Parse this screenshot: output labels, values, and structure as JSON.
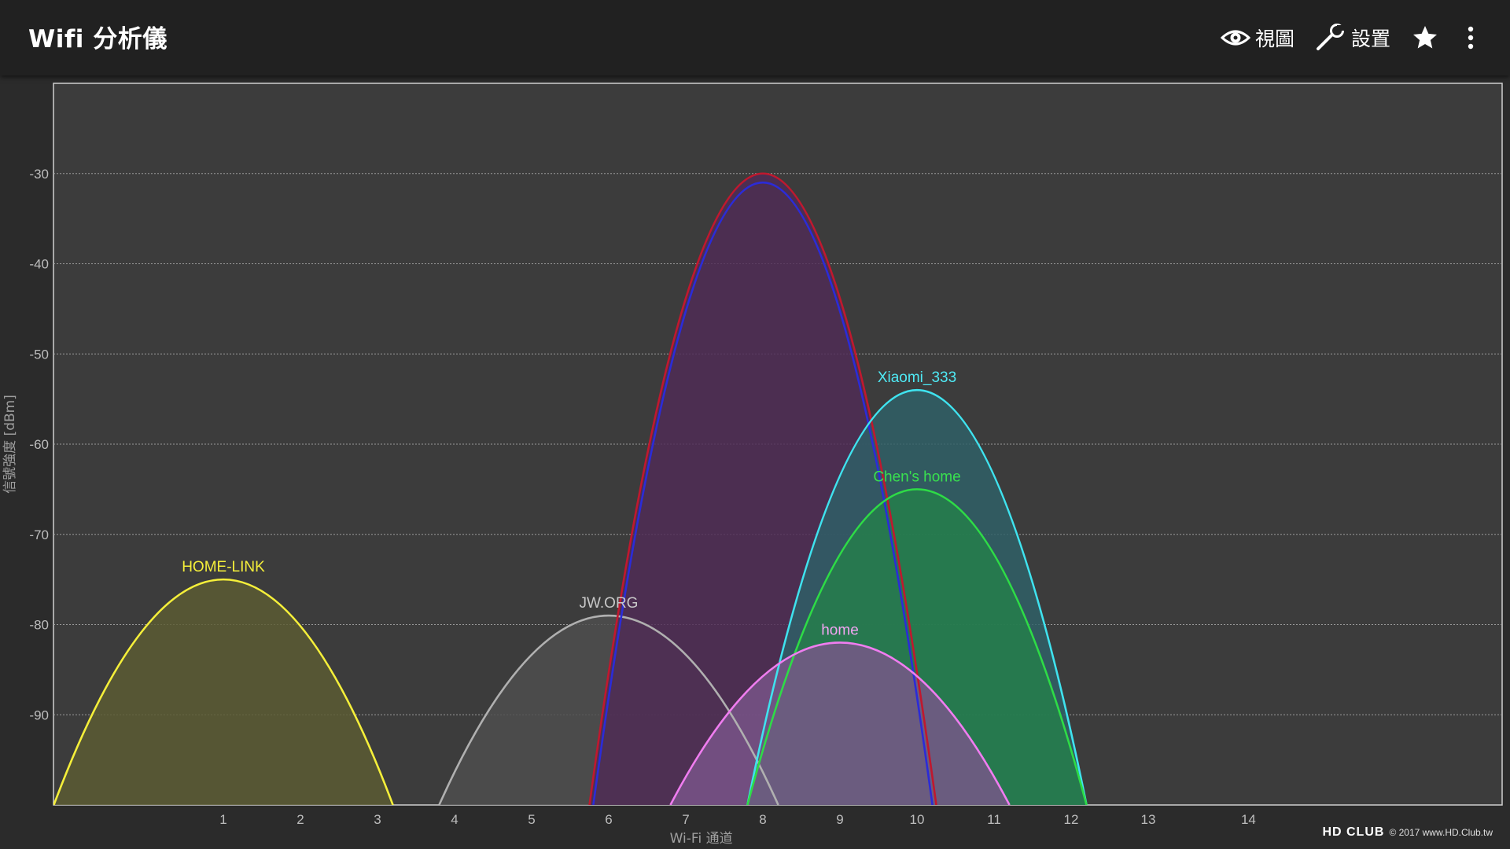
{
  "appbar": {
    "title": "Wifi 分析儀",
    "view_label": "視圖",
    "settings_label": "設置",
    "view_icon": "eye-icon",
    "settings_icon": "wrench-icon",
    "favorite_icon": "star-icon",
    "more_icon": "more-vert-icon"
  },
  "chart_data": {
    "type": "area",
    "xlabel": "Wi-Fi 通道",
    "ylabel": "信號強度 [dBm]",
    "x_ticks": [
      "1",
      "2",
      "3",
      "4",
      "5",
      "6",
      "7",
      "8",
      "9",
      "10",
      "11",
      "12",
      "13",
      "14"
    ],
    "y_ticks": [
      "-30",
      "-40",
      "-50",
      "-60",
      "-70",
      "-80",
      "-90"
    ],
    "ylim": [
      -100,
      -20
    ],
    "grid": true,
    "series": [
      {
        "name": "HOME-LINK",
        "channel": 1,
        "start": -1.2,
        "end": 3.2,
        "peak": -75,
        "stroke": "#f5ef3a",
        "fill": "#5c5b32",
        "label_color": "#f5ef3a",
        "show_label": true
      },
      {
        "name": "JW.ORG",
        "channel": 6,
        "start": 3.8,
        "end": 8.2,
        "peak": -79,
        "stroke": "#b0b0b0",
        "fill": "#4e4e4e",
        "label_color": "#c8c8c8",
        "show_label": true
      },
      {
        "name": "",
        "channel": 8,
        "start": 5.75,
        "end": 10.25,
        "peak": -30,
        "stroke": "#c0182e",
        "fill": "#4f2b55",
        "label_color": "#c0182e",
        "show_label": false
      },
      {
        "name": "",
        "channel": 8,
        "start": 5.8,
        "end": 10.2,
        "peak": -31,
        "stroke": "#2b2bd8",
        "fill": "none",
        "label_color": "#2b2bd8",
        "show_label": false
      },
      {
        "name": "Xiaomi_333",
        "channel": 10,
        "start": 7.8,
        "end": 12.2,
        "peak": -54,
        "stroke": "#3fe3ef",
        "fill": "#2e6068",
        "label_color": "#4feaf5",
        "show_label": true
      },
      {
        "name": "Chen's home",
        "channel": 10,
        "start": 7.8,
        "end": 12.2,
        "peak": -65,
        "stroke": "#2edc46",
        "fill": "#25804a",
        "label_color": "#39e04f",
        "show_label": true
      },
      {
        "name": "home",
        "channel": 9,
        "start": 6.8,
        "end": 11.2,
        "peak": -82,
        "stroke": "#f07df0",
        "fill": "#7a568a",
        "label_color": "#f3a5f3",
        "show_label": true
      }
    ]
  },
  "watermark": {
    "logo": "HD CLUB",
    "text": "© 2017 www.HD.Club.tw"
  }
}
